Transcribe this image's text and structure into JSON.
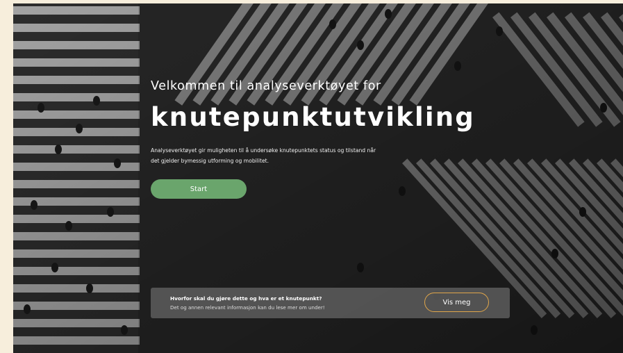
{
  "hero": {
    "welcome": "Velkommen til analyseverktøyet for",
    "headline": "knutepunktutvikling",
    "description": "Analyseverktøyet gir muligheten til å undersøke knutepunktets status og tilstand når det gjelder bymessig utforming og mobilitet.",
    "start_label": "Start"
  },
  "info": {
    "title": "Hvorfor skal du gjøre dette og hva er et knutepunkt?",
    "subtitle": "Det og annen relevant informasjon kan du lese mer om under!",
    "button_label": "Vis meg"
  },
  "colors": {
    "page_bg": "#f7eedc",
    "start_button": "#6aa56c",
    "vis_meg_border": "#e0a64a",
    "info_bar": "#5f5f5f"
  },
  "icons": {
    "background": "crosswalk-aerial-photo"
  }
}
